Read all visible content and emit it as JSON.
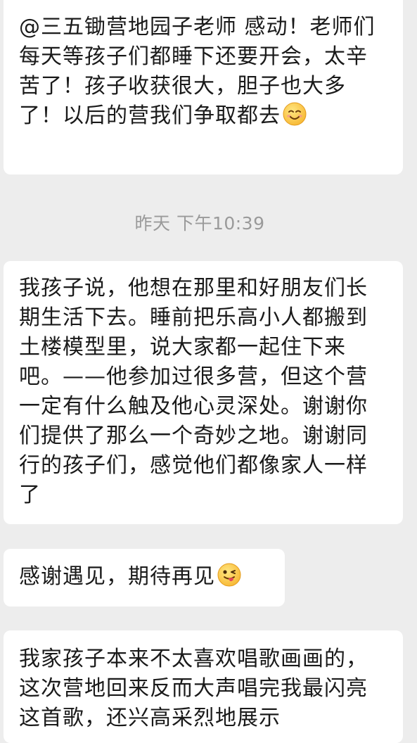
{
  "messages": [
    {
      "text": "@三五锄营地园子老师 感动！老师们每天等孩子们都睡下还要开会，太辛苦了！孩子收获很大，胆子也大多了！以后的营我们争取都去",
      "emoji": "smiling-face-emoji"
    },
    {
      "text": "我孩子说，他想在那里和好朋友们长期生活下去。睡前把乐高小人都搬到土楼模型里，说大家都一起住下来吧。——他参加过很多营，但这个营一定有什么触及他心灵深处。谢谢你们提供了那么一个奇妙之地。谢谢同行的孩子们，感觉他们都像家人一样了"
    },
    {
      "text": "感谢遇见，期待再见",
      "emoji": "winking-tongue-face-emoji"
    },
    {
      "text": "我家孩子本来不太喜欢唱歌画画的，这次营地回来反而大声唱完我最闪亮这首歌，还兴高采烈地展示"
    }
  ],
  "timestamp": "昨天 下午10:39",
  "colors": {
    "background": "#ededed",
    "bubble": "#ffffff",
    "timestamp": "#9a9a9a"
  }
}
